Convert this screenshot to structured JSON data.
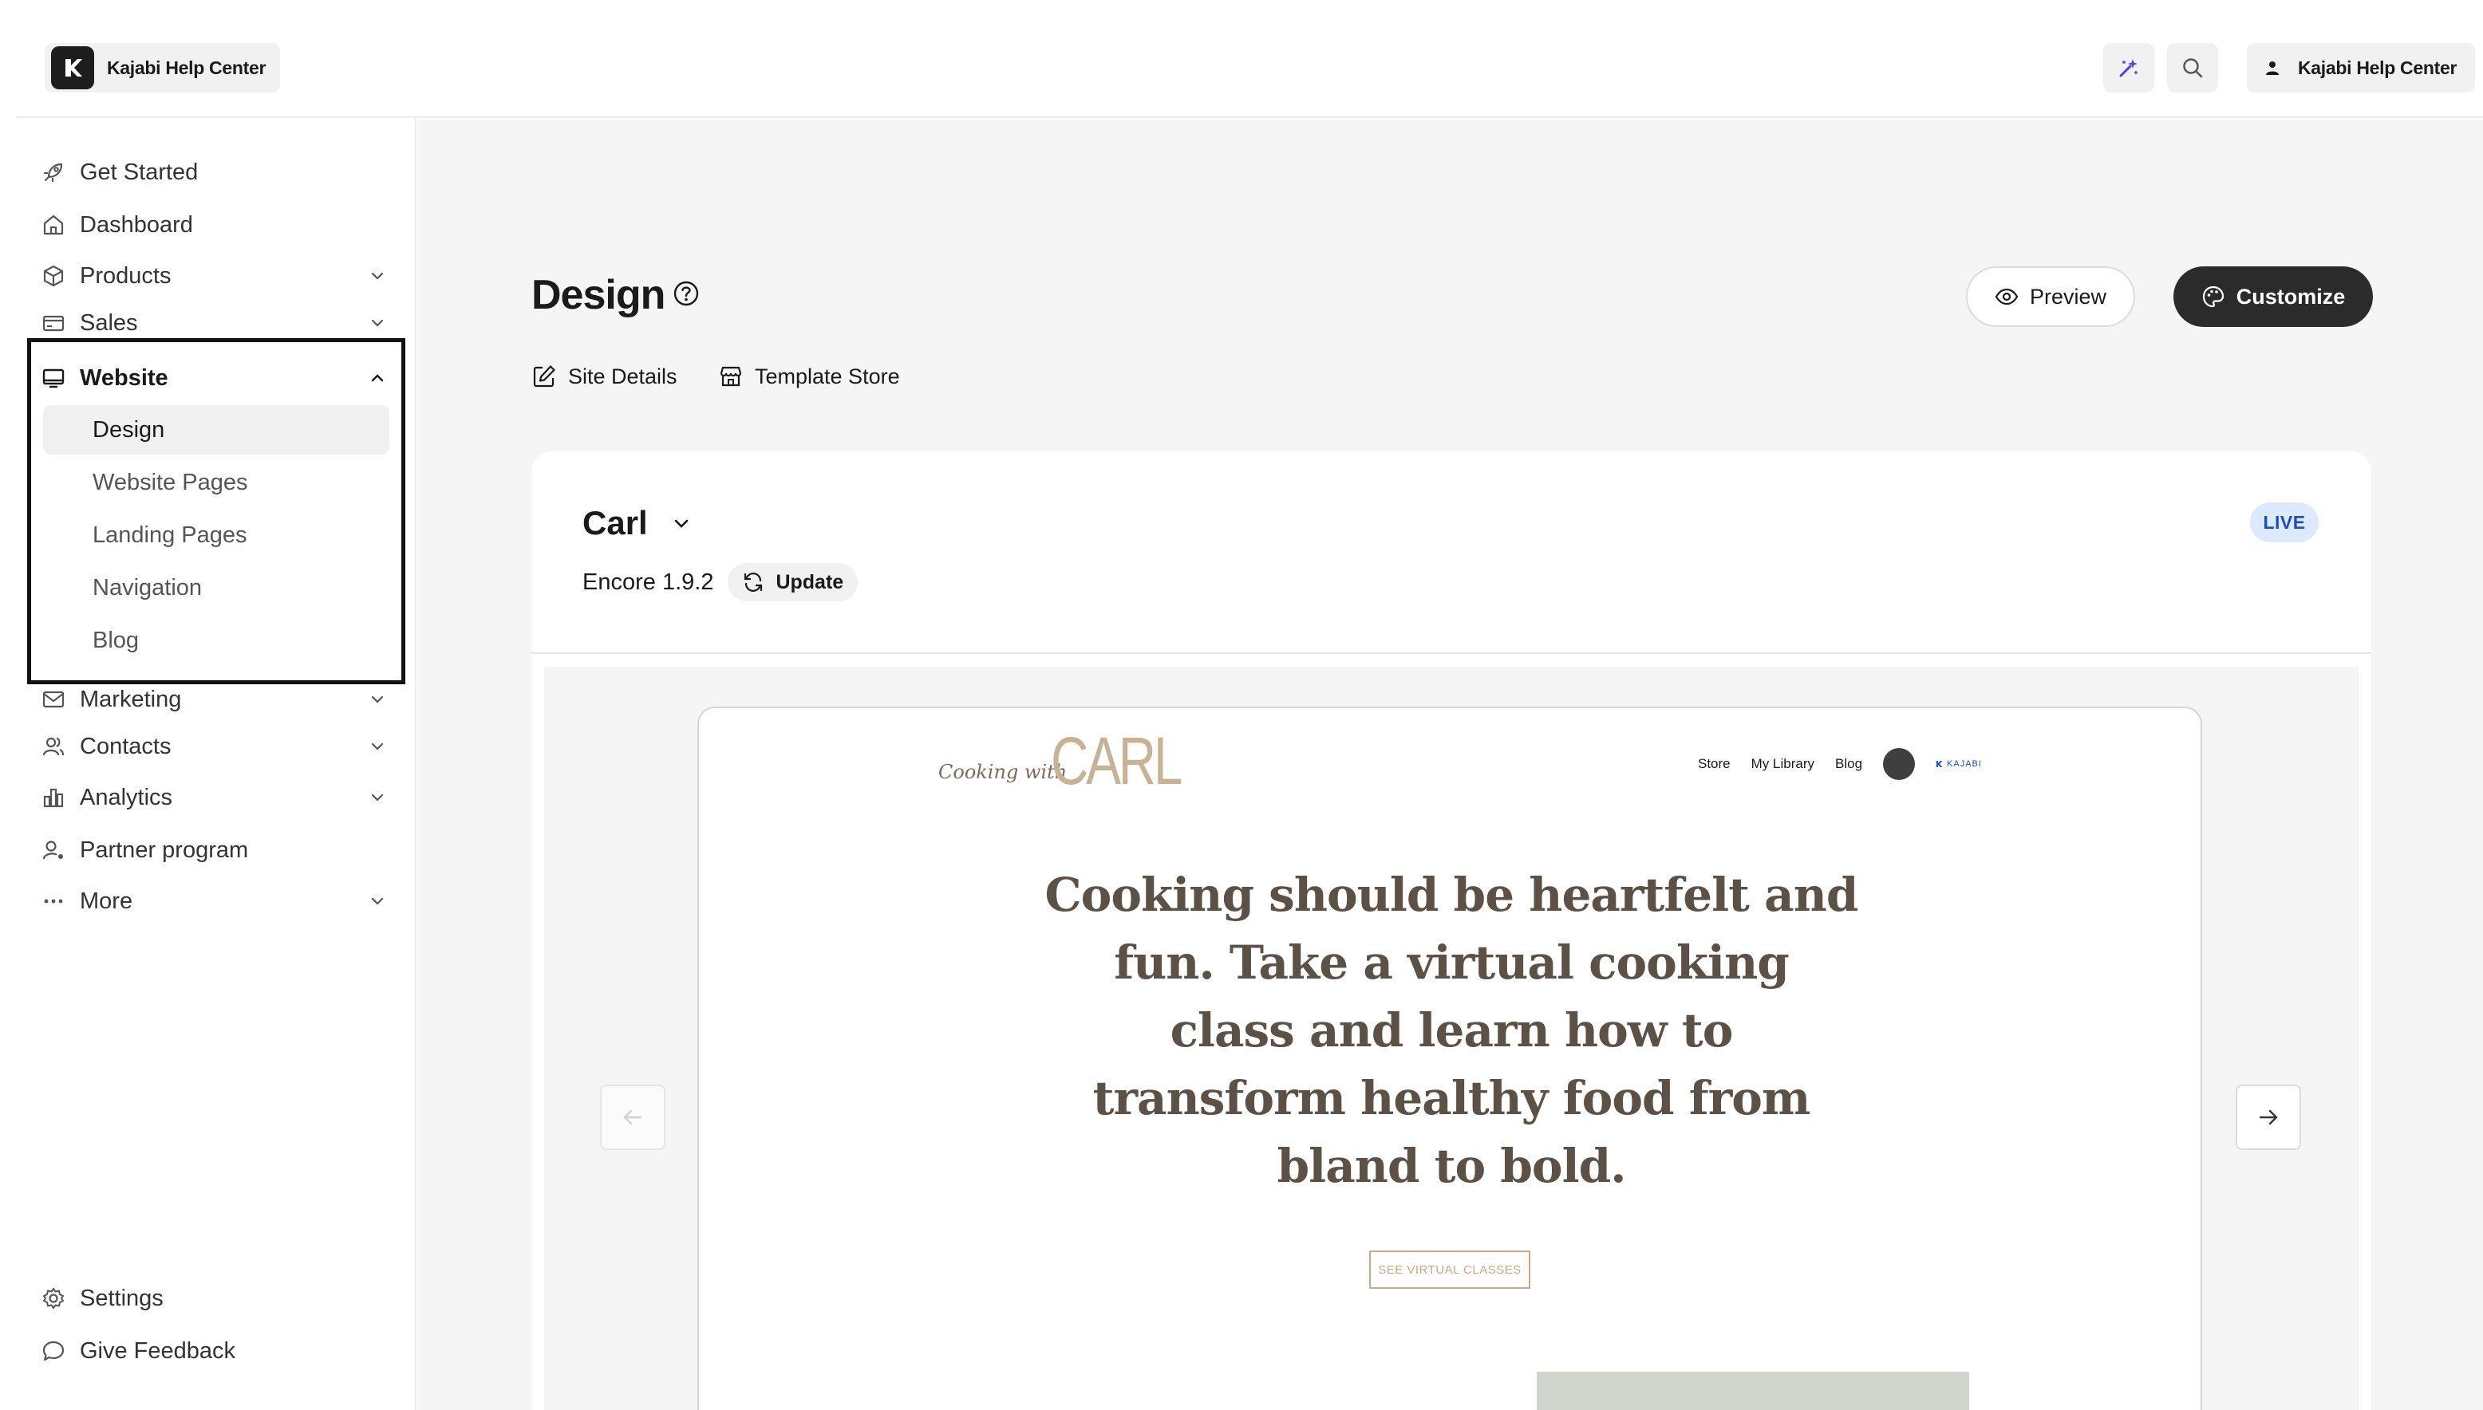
{
  "topbar": {
    "brand_name": "Kajabi Help Center",
    "account_label": "Kajabi Help Center"
  },
  "sidebar": {
    "items": [
      {
        "label": "Get Started",
        "icon": "rocket-icon"
      },
      {
        "label": "Dashboard",
        "icon": "home-icon"
      },
      {
        "label": "Products",
        "icon": "box-icon",
        "expandable": true
      },
      {
        "label": "Sales",
        "icon": "credit-card-icon",
        "expandable": true
      },
      {
        "label": "Website",
        "icon": "monitor-icon",
        "expanded": true
      },
      {
        "label": "Marketing",
        "icon": "mail-icon",
        "expandable": true
      },
      {
        "label": "Contacts",
        "icon": "users-icon",
        "expandable": true
      },
      {
        "label": "Analytics",
        "icon": "bar-chart-icon",
        "expandable": true
      },
      {
        "label": "Partner program",
        "icon": "partner-icon"
      },
      {
        "label": "More",
        "icon": "ellipsis-icon",
        "expandable": true
      }
    ],
    "website_sub": [
      "Design",
      "Website Pages",
      "Landing Pages",
      "Navigation",
      "Blog"
    ],
    "active_sub": "Design",
    "footer": [
      {
        "label": "Settings",
        "icon": "gear-icon"
      },
      {
        "label": "Give Feedback",
        "icon": "chat-bubble-icon"
      }
    ]
  },
  "main": {
    "title": "Design",
    "preview_label": "Preview",
    "customize_label": "Customize",
    "tabs": [
      "Site Details",
      "Template Store"
    ],
    "theme": {
      "name": "Carl",
      "version": "Encore 1.9.2",
      "update_label": "Update",
      "status": "LIVE"
    },
    "site_preview": {
      "logo_script": "Cooking with",
      "logo_big": "CARL",
      "nav": [
        "Store",
        "My Library",
        "Blog"
      ],
      "brand_mark": "KAJABI",
      "hero_lines": [
        "Cooking should be heartfelt and",
        "fun. Take a virtual cooking",
        "class and learn how to",
        "transform healthy food from",
        "bland to bold."
      ],
      "cta": "SEE VIRTUAL CLASSES"
    }
  },
  "colors": {
    "accent_dark": "#2b2b2b",
    "live_bg": "#dce9ff",
    "live_text": "#1d4fb8",
    "hero_text": "#5c5147",
    "logo_tan": "#c7b295",
    "ai_icon": "#5b3fd6"
  }
}
